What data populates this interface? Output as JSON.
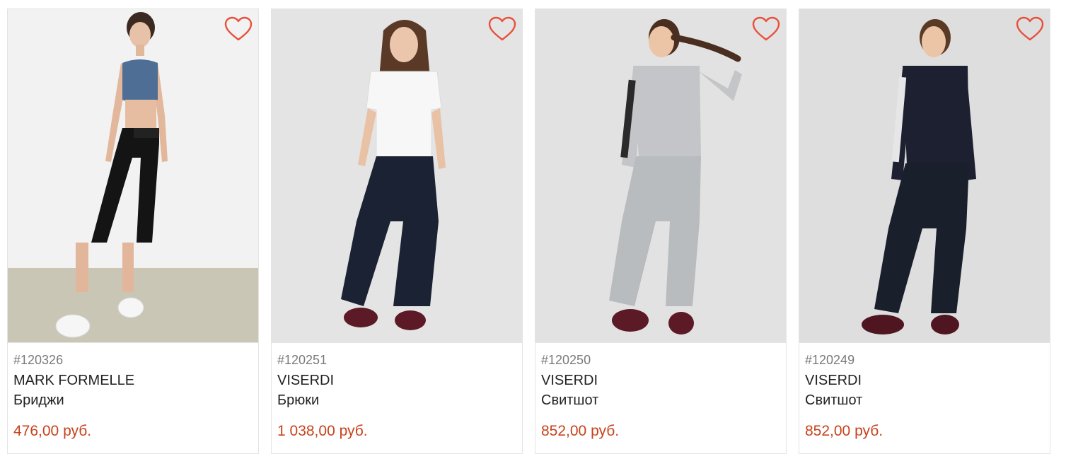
{
  "colors": {
    "accent_price": "#c8421c",
    "heart_outline": "#e8503a",
    "card_border": "#e4e4e4"
  },
  "products": [
    {
      "sku": "#120326",
      "brand": "MARK FORMELLE",
      "name": "Бриджи",
      "price": "476,00 руб.",
      "favorite_icon": "heart-outline-icon"
    },
    {
      "sku": "#120251",
      "brand": "VISERDI",
      "name": "Брюки",
      "price": "1 038,00 руб.",
      "favorite_icon": "heart-outline-icon"
    },
    {
      "sku": "#120250",
      "brand": "VISERDI",
      "name": "Свитшот",
      "price": "852,00 руб.",
      "favorite_icon": "heart-outline-icon"
    },
    {
      "sku": "#120249",
      "brand": "VISERDI",
      "name": "Свитшот",
      "price": "852,00 руб.",
      "favorite_icon": "heart-outline-icon"
    }
  ]
}
